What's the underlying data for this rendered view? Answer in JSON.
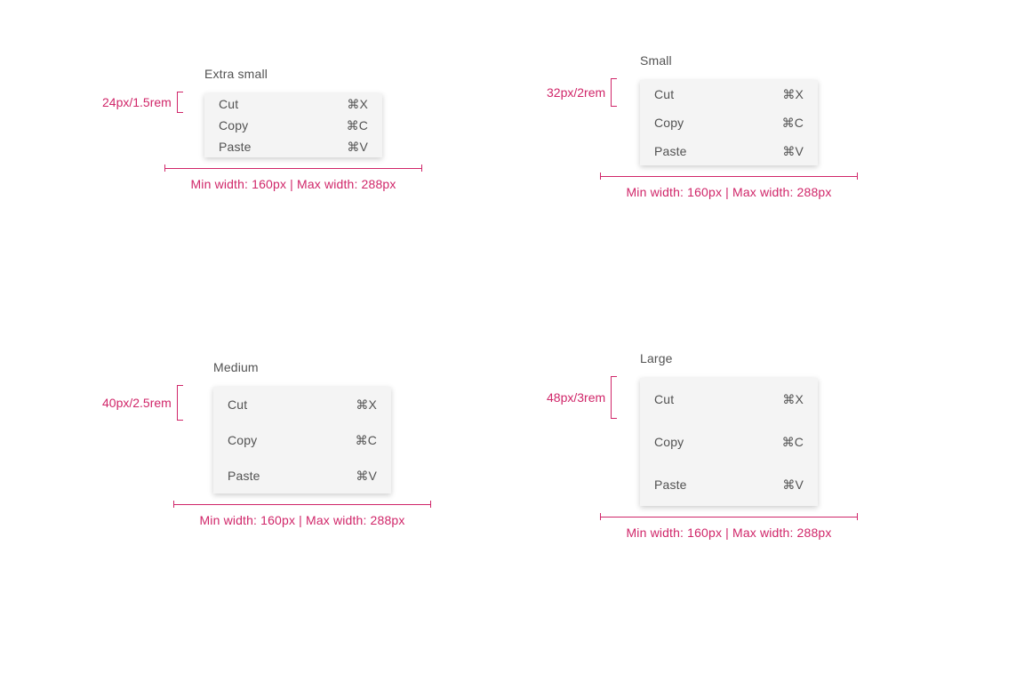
{
  "widthLabel": "Min width: 160px | Max width: 288px",
  "menuItems": [
    {
      "label": "Cut",
      "shortcut": "⌘X"
    },
    {
      "label": "Copy",
      "shortcut": "⌘C"
    },
    {
      "label": "Paste",
      "shortcut": "⌘V"
    }
  ],
  "variants": {
    "xs": {
      "title": "Extra small",
      "heightSpec": "24px/1.5rem"
    },
    "sm": {
      "title": "Small",
      "heightSpec": "32px/2rem"
    },
    "md": {
      "title": "Medium",
      "heightSpec": "40px/2.5rem"
    },
    "lg": {
      "title": "Large",
      "heightSpec": "48px/3rem"
    }
  }
}
